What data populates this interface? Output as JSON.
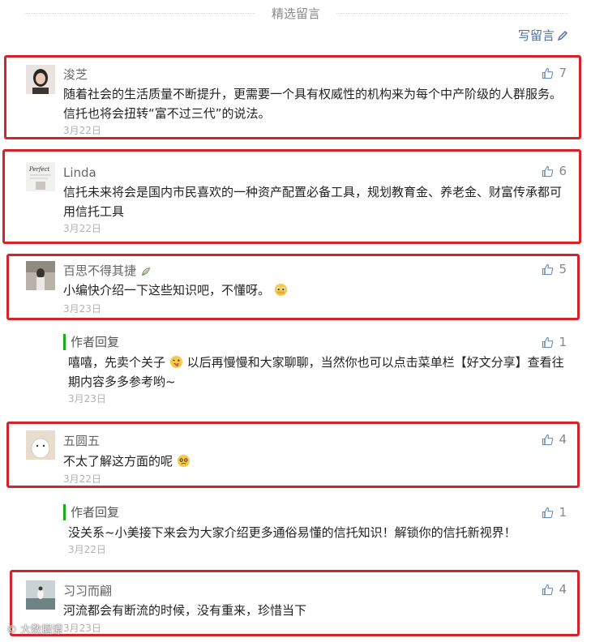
{
  "section": {
    "title": "精选留言",
    "write_label": "写留言"
  },
  "comments": [
    {
      "nick": "浚芝",
      "content": "随着社会的生活质量不断提升，更需要一个具有权威性的机构来为每个中产阶级的人群服务。信托也将会扭转“富不过三代”的说法。",
      "date": "3月22日",
      "likes": "7"
    },
    {
      "nick": "Linda",
      "content": "信托未来将会是国内市民喜欢的一种资产配置必备工具，规划教育金、养老金、财富传承都可用信托工具",
      "date": "3月22日",
      "likes": "6"
    },
    {
      "nick": "百思不得其捷",
      "content": "小编快介绍一下这些知识吧，不懂呀。",
      "date": "3月23日",
      "likes": "5",
      "reply": {
        "label": "作者回复",
        "content_a": "嘻嘻，先卖个关子",
        "content_b": "以后再慢慢和大家聊聊，当然你也可以点击菜单栏【好文分享】查看往期内容多多参考哟~",
        "date": "3月23日",
        "likes": "1"
      }
    },
    {
      "nick": "五圆五",
      "content": "不太了解这方面的呢",
      "date": "3月22日",
      "likes": "4",
      "reply": {
        "label": "作者回复",
        "content": "没关系~小美接下来会为大家介绍更多通俗易懂的信托知识！解锁你的信托新视界！",
        "date": "3月22日",
        "likes": "1"
      }
    },
    {
      "nick": "习习而翩",
      "content": "河流都会有断流的时候，没有重来，珍惜当下",
      "date": "3月23日",
      "likes": "4"
    }
  ],
  "watermark": "大数据谭"
}
